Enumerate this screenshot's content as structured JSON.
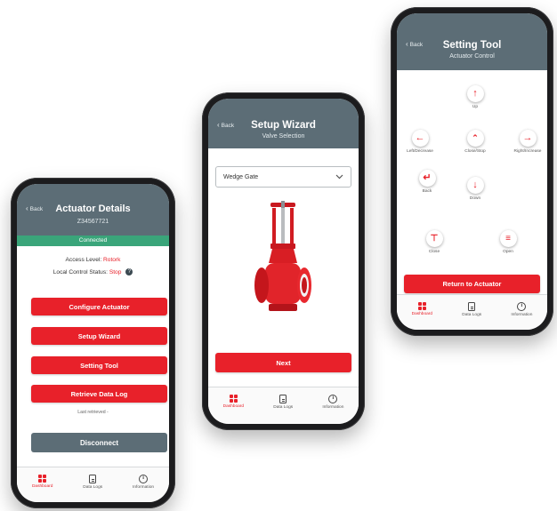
{
  "theme": {
    "accent": "#e8212a",
    "header": "#5c6d76",
    "connected": "#3aa57a"
  },
  "phone1": {
    "back_label": "Back",
    "title": "Actuator Details",
    "subtitle": "Z34567721",
    "status_text": "Connected",
    "access_label": "Access Level:",
    "access_value": "Rotork",
    "local_control_label": "Local Control Status:",
    "local_control_value": "Stop",
    "help_icon": "question-circle-icon",
    "buttons": {
      "configure": "Configure Actuator",
      "setup_wizard": "Setup Wizard",
      "setting_tool": "Setting Tool",
      "retrieve": "Retrieve Data Log"
    },
    "last_retrieved": "Last retrieved -",
    "disconnect": "Disconnect",
    "tabs": [
      "Dashboard",
      "Data Logs",
      "Information"
    ]
  },
  "phone2": {
    "back_label": "Back",
    "title": "Setup Wizard",
    "subtitle": "Valve Selection",
    "dropdown_value": "Wedge Gate",
    "next": "Next",
    "tabs": [
      "Dashboard",
      "Data Logs",
      "Information"
    ]
  },
  "phone3": {
    "back_label": "Back",
    "title": "Setting Tool",
    "subtitle": "Actuator Control",
    "controls": {
      "up": "Up",
      "left": "Left/Decrease",
      "close_stop": "Close/Stop",
      "right": "Right/Increase",
      "back": "Back",
      "down": "Down",
      "close": "Close",
      "open": "Open"
    },
    "return": "Return to Actuator",
    "tabs": [
      "Dashboard",
      "Data Logs",
      "Information"
    ]
  }
}
